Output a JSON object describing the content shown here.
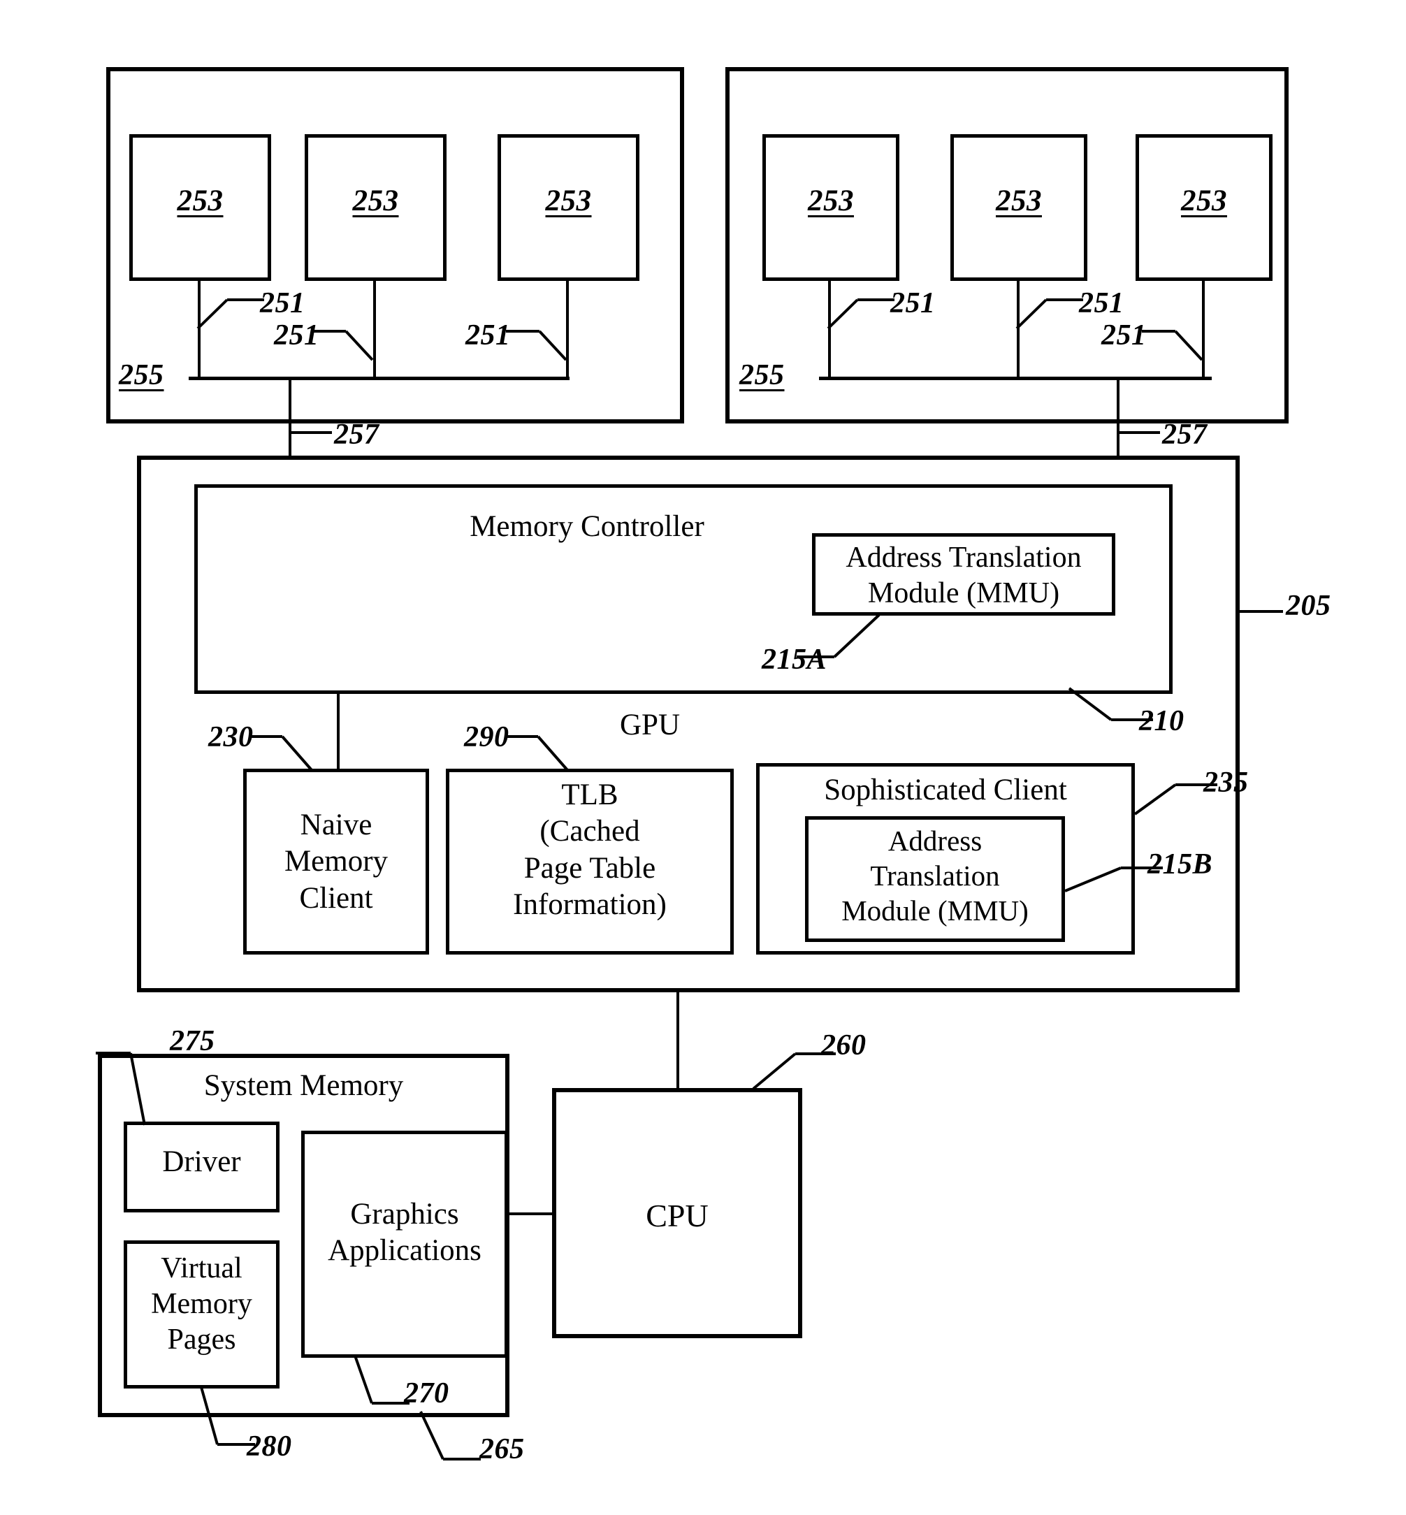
{
  "figure": {
    "type": "patent-block-diagram",
    "title": "GPU memory subsystem block diagram"
  },
  "client_group_left": {
    "ref": "255",
    "units": [
      {
        "ref": "253"
      },
      {
        "ref": "253"
      },
      {
        "ref": "253"
      }
    ],
    "connections": [
      {
        "ref": "251"
      },
      {
        "ref": "251"
      },
      {
        "ref": "251"
      }
    ],
    "bus_ref": "257"
  },
  "client_group_right": {
    "ref": "255",
    "units": [
      {
        "ref": "253"
      },
      {
        "ref": "253"
      },
      {
        "ref": "253"
      }
    ],
    "connections": [
      {
        "ref": "251"
      },
      {
        "ref": "251"
      },
      {
        "ref": "251"
      }
    ],
    "bus_ref": "257"
  },
  "gpu": {
    "label": "GPU",
    "ref": "205",
    "memory_controller": {
      "label": "Memory Controller",
      "ref": "210",
      "mmu": {
        "label": "Address Translation\nModule (MMU)",
        "ref": "215A"
      }
    },
    "naive_client": {
      "label": "Naive\nMemory\nClient",
      "ref": "230"
    },
    "tlb": {
      "label": "TLB\n(Cached\nPage Table\nInformation)",
      "ref": "290"
    },
    "sophisticated_client": {
      "label": "Sophisticated Client",
      "ref": "235",
      "mmu": {
        "label": "Address\nTranslation\nModule (MMU)",
        "ref": "215B"
      }
    }
  },
  "system_memory": {
    "label": "System Memory",
    "ref": "265",
    "driver": {
      "label": "Driver",
      "ref": "275"
    },
    "virtual_memory_pages": {
      "label": "Virtual\nMemory\nPages",
      "ref": "280"
    },
    "graphics_applications": {
      "label": "Graphics\nApplications",
      "ref": "270"
    }
  },
  "cpu": {
    "label": "CPU",
    "ref": "260"
  },
  "colors": {
    "stroke": "#000000",
    "background": "#ffffff"
  }
}
